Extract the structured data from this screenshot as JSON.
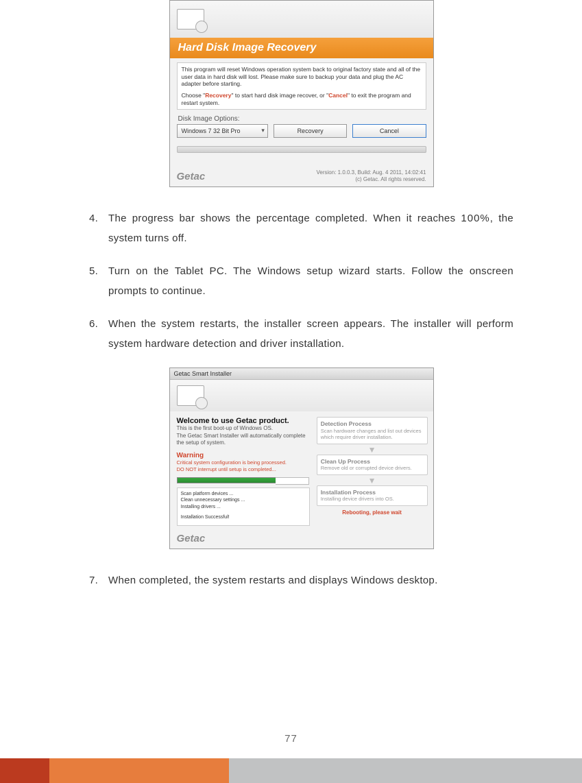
{
  "page_number": "77",
  "screenshot1": {
    "title": "Hard Disk Image Recovery",
    "panel_line1": "This program will reset Windows operation system back to original factory state and all of the user data in hard disk will lost. Please make sure to backup your data and plug the AC adapter before starting.",
    "panel_line2a": "Choose \"",
    "panel_kw1": "Recovery",
    "panel_line2b": "\" to start hard disk image recover, or \"",
    "panel_kw2": "Cancel",
    "panel_line2c": "\" to exit the program and restart system.",
    "options_label": "Disk Image Options:",
    "combo_value": "Windows 7 32 Bit Pro",
    "btn_recovery": "Recovery",
    "btn_cancel": "Cancel",
    "brand": "Getac",
    "version": "Version: 1.0.0.3, Build: Aug. 4 2011, 14:02:41",
    "copyright": "(c) Getac. All rights reserved."
  },
  "steps": [
    {
      "n": "4.",
      "text_a": "The progress bar shows the percentage completed. When it reaches ",
      "kw": "100%",
      "text_b": ", the system turns off."
    },
    {
      "n": "5.",
      "text": "Turn on the Tablet PC. The Windows setup wizard starts. Follow the onscreen prompts to continue."
    },
    {
      "n": "6.",
      "text": "When the system restarts, the installer screen appears. The installer will perform system hardware detection and driver installation."
    }
  ],
  "screenshot2": {
    "titlebar": "Getac Smart Installer",
    "welcome": "Welcome to use Getac product.",
    "sub1": "This is the first boot-up of Windows OS.",
    "sub2": "The Getac Smart Installer will automatically complete the setup of system.",
    "warn_h": "Warning",
    "warn1": "Critical system configuration is being processed.",
    "warn2": "DO NOT interrupt until setup is completed...",
    "log1": "Scan platform devices ...",
    "log2": "Clean unnecessary settings ...",
    "log3": "Installing drivers ...",
    "log4": "Installation Successful!",
    "card1_h": "Detection Process",
    "card1_t": "Scan hardware changes and list out devices which require driver installation.",
    "card2_h": "Clean Up Process",
    "card2_t": "Remove old or corrupted device drivers.",
    "card3_h": "Installation Process",
    "card3_t": "Installing device drivers into OS.",
    "reboot": "Rebooting, please wait",
    "brand": "Getac"
  },
  "step7": {
    "n": "7.",
    "text": "When completed, the system restarts and displays Windows desktop."
  }
}
